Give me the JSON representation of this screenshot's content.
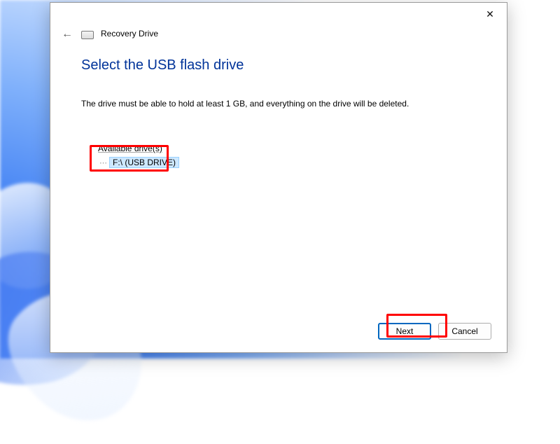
{
  "window": {
    "title": "Recovery Drive"
  },
  "page": {
    "title": "Select the USB flash drive",
    "instruction": "The drive must be able to hold at least 1 GB, and everything on the drive will be deleted."
  },
  "drives": {
    "section_label": "Available drive(s)",
    "items": [
      {
        "label": "F:\\ (USB DRIVE)",
        "selected": true
      }
    ]
  },
  "buttons": {
    "next": "Next",
    "cancel": "Cancel"
  },
  "icons": {
    "close": "✕",
    "back": "←",
    "tree": "⋯"
  }
}
